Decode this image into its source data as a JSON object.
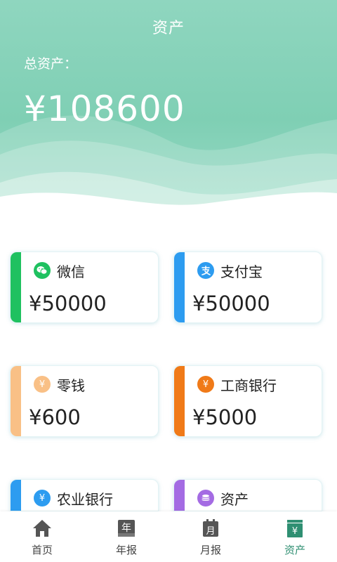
{
  "header": {
    "title": "资产",
    "total_label": "总资产：",
    "total_amount": "¥108600"
  },
  "colors": {
    "header_green": "#85d2b8",
    "wechat": "#1fc160",
    "alipay": "#2d9cf0",
    "cash": "#f9c086",
    "icbc": "#f07a18",
    "abc": "#2d9cf0",
    "asset": "#a46be3",
    "tab_active": "#2f8f72"
  },
  "accounts": [
    {
      "name": "微信",
      "amount": "¥50000",
      "icon": "wechat-icon"
    },
    {
      "name": "支付宝",
      "amount": "¥50000",
      "icon": "alipay-icon"
    },
    {
      "name": "零钱",
      "amount": "¥600",
      "icon": "yuan-coin-icon"
    },
    {
      "name": "工商银行",
      "amount": "¥5000",
      "icon": "yuan-coin-icon"
    },
    {
      "name": "农业银行",
      "amount": "",
      "icon": "yuan-coin-icon"
    },
    {
      "name": "资产",
      "amount": "",
      "icon": "coin-stack-icon"
    }
  ],
  "tabs": [
    {
      "label": "首页",
      "icon": "home-icon"
    },
    {
      "label": "年报",
      "icon": "year-report-icon"
    },
    {
      "label": "月报",
      "icon": "month-calendar-icon"
    },
    {
      "label": "资产",
      "icon": "asset-wallet-icon",
      "active": true
    }
  ]
}
